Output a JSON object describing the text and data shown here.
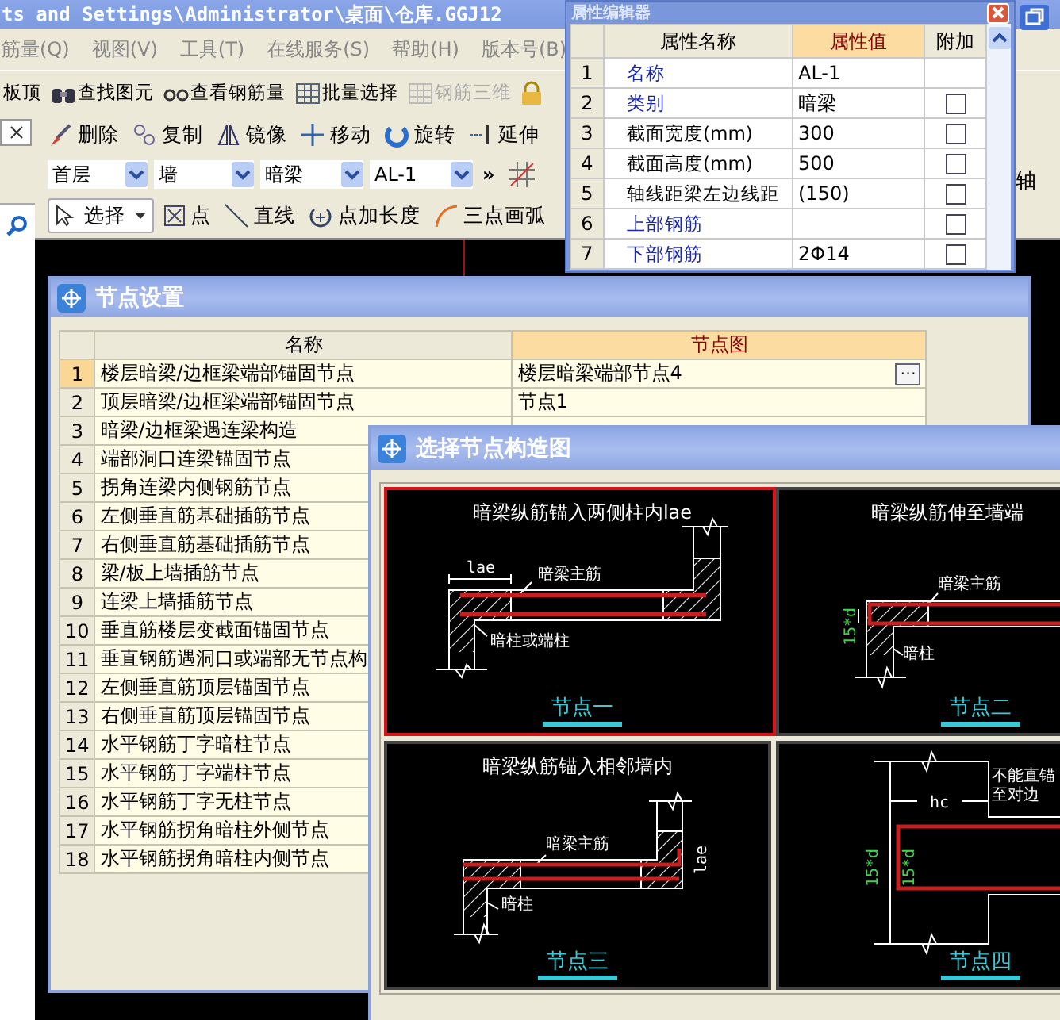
{
  "main_window": {
    "title": "ts and Settings\\Administrator\\桌面\\仓库.GGJ12",
    "menu": [
      "筋量(Q)",
      "视图(V)",
      "工具(T)",
      "在线服务(S)",
      "帮助(H)",
      "版本号(B)"
    ],
    "toolbar": [
      {
        "label": "板顶",
        "disabled": false
      },
      {
        "label": "查找图元",
        "disabled": false
      },
      {
        "label": "查看钢筋量",
        "disabled": false
      },
      {
        "label": "批量选择",
        "disabled": false
      },
      {
        "label": "钢筋三维",
        "disabled": true
      }
    ],
    "edit_toolbar": [
      "删除",
      "复制",
      "镜像",
      "移动",
      "旋转",
      "延伸"
    ],
    "selectors": [
      "首层",
      "墙",
      "暗梁",
      "AL-1"
    ],
    "overflow": "»",
    "draw_toolbar": [
      "选择",
      "点",
      "直线",
      "点加长度",
      "三点画弧"
    ],
    "side_label": "轴"
  },
  "property_editor": {
    "title": "属性编辑器",
    "columns": [
      "属性名称",
      "属性值",
      "附加"
    ],
    "rows": [
      {
        "index": "1",
        "name": "名称",
        "value": "AL-1",
        "kind": "public"
      },
      {
        "index": "2",
        "name": "类别",
        "value": "暗梁",
        "kind": "public",
        "checked": false
      },
      {
        "index": "3",
        "name": "截面宽度(mm)",
        "value": "300",
        "kind": "private",
        "checked": false
      },
      {
        "index": "4",
        "name": "截面高度(mm)",
        "value": "500",
        "kind": "private",
        "checked": false
      },
      {
        "index": "5",
        "name": "轴线距梁左边线距",
        "value": "(150)",
        "kind": "private",
        "checked": false
      },
      {
        "index": "6",
        "name": "上部钢筋",
        "kind": "public",
        "checked": false
      },
      {
        "index": "7",
        "name": "下部钢筋",
        "value": "2Φ14",
        "kind": "public",
        "checked": false
      }
    ]
  },
  "node_settings": {
    "title": "节点设置",
    "columns": [
      "名称",
      "节点图"
    ],
    "rows": [
      {
        "index": "1",
        "name": "楼层暗梁/边框梁端部锚固节点",
        "value": "楼层暗梁端部节点4",
        "edit_button": "···",
        "selected": true
      },
      {
        "index": "2",
        "name": "顶层暗梁/边框梁端部锚固节点",
        "value": "节点1",
        "selected": false
      },
      {
        "index": "3",
        "name": "暗梁/边框梁遇连梁构造",
        "selected": false
      },
      {
        "index": "4",
        "name": "端部洞口连梁锚固节点",
        "selected": false
      },
      {
        "index": "5",
        "name": "拐角连梁内侧钢筋节点",
        "selected": false
      },
      {
        "index": "6",
        "name": "左侧垂直筋基础插筋节点",
        "selected": false
      },
      {
        "index": "7",
        "name": "右侧垂直筋基础插筋节点",
        "selected": false
      },
      {
        "index": "8",
        "name": "梁/板上墙插筋节点",
        "selected": false
      },
      {
        "index": "9",
        "name": "连梁上墙插筋节点",
        "selected": false
      },
      {
        "index": "10",
        "name": "垂直筋楼层变截面锚固节点",
        "selected": false
      },
      {
        "index": "11",
        "name": "垂直钢筋遇洞口或端部无节点构",
        "selected": false
      },
      {
        "index": "12",
        "name": "左侧垂直筋顶层锚固节点",
        "selected": false
      },
      {
        "index": "13",
        "name": "右侧垂直筋顶层锚固节点",
        "selected": false
      },
      {
        "index": "14",
        "name": "水平钢筋丁字暗柱节点",
        "selected": false
      },
      {
        "index": "15",
        "name": "水平钢筋丁字端柱节点",
        "selected": false
      },
      {
        "index": "16",
        "name": "水平钢筋丁字无柱节点",
        "selected": false
      },
      {
        "index": "17",
        "name": "水平钢筋拐角暗柱外侧节点",
        "selected": false
      },
      {
        "index": "18",
        "name": "水平钢筋拐角暗柱内侧节点",
        "selected": false
      }
    ]
  },
  "node_picker": {
    "title": "选择节点构造图",
    "options": [
      {
        "kind": "two-columns",
        "title": "暗梁纵筋锚入两侧柱内lae",
        "labels": [
          "lae",
          "暗梁主筋",
          "暗柱或端柱"
        ],
        "caption": "节点一",
        "selected": true
      },
      {
        "kind": "wall-end",
        "title": "暗梁纵筋伸至墙端",
        "labels": [
          "暗梁主筋",
          "15*d",
          "暗柱"
        ],
        "caption": "节点二",
        "selected": false
      },
      {
        "kind": "adjacent-wall",
        "title": "暗梁纵筋锚入相邻墙内",
        "labels": [
          "暗梁主筋",
          "暗柱",
          "lae"
        ],
        "caption": "节点三",
        "selected": false
      },
      {
        "kind": "column-bend",
        "labels": [
          "不能直锚",
          "hc",
          "至对边",
          "15*d",
          "15*d"
        ],
        "caption": "节点四",
        "selected": false
      }
    ]
  }
}
